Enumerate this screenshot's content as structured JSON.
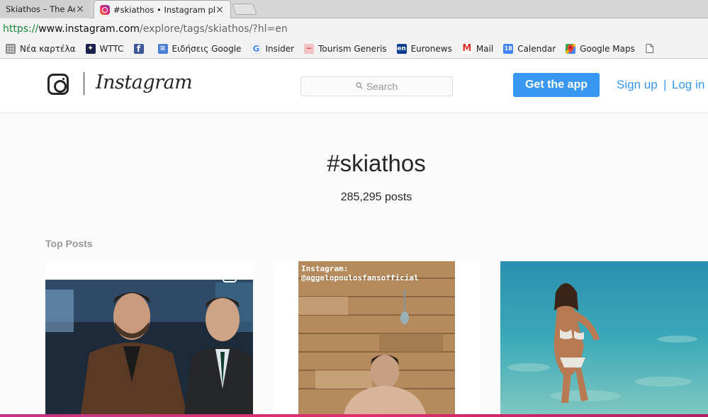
{
  "browser": {
    "tabs": [
      {
        "title": "Skiathos – The Aeg",
        "active": false
      },
      {
        "title": "#skiathos • Instagram pho",
        "active": true
      }
    ],
    "url": {
      "scheme": "https://",
      "host": "www.instagram.com",
      "path": "/explore/tags/skiathos/?hl=en"
    },
    "bookmarks": [
      {
        "label": "Νέα καρτέλα",
        "icon": "apps-grid-icon"
      },
      {
        "label": "WTTC",
        "icon": "wttc-icon"
      },
      {
        "label": "",
        "icon": "facebook-icon"
      },
      {
        "label": "Ειδήσεις Google",
        "icon": "google-news-icon"
      },
      {
        "label": "Insider",
        "icon": "google-icon"
      },
      {
        "label": "Tourism Generis",
        "icon": "tourism-generis-icon"
      },
      {
        "label": "Euronews",
        "icon": "euronews-icon"
      },
      {
        "label": "Mail",
        "icon": "gmail-icon"
      },
      {
        "label": "Calendar",
        "icon": "calendar-icon"
      },
      {
        "label": "Google Maps",
        "icon": "google-maps-icon"
      },
      {
        "label": "",
        "icon": "document-icon"
      }
    ],
    "close_glyph": "×"
  },
  "header": {
    "logo_text": "Instagram",
    "search_placeholder": "Search",
    "get_app_label": "Get the app",
    "sign_up_label": "Sign up",
    "separator": "|",
    "log_in_label": "Log in"
  },
  "main": {
    "hashtag": "#skiathos",
    "post_count": "285,295 posts",
    "section_title": "Top Posts",
    "post2_overlay_text": [
      "Instagram:",
      "@aggelopoulosfansofficial"
    ]
  },
  "colors": {
    "accent": "#3897f0",
    "text": "#262626",
    "muted": "#999999",
    "background": "#fafafa"
  }
}
